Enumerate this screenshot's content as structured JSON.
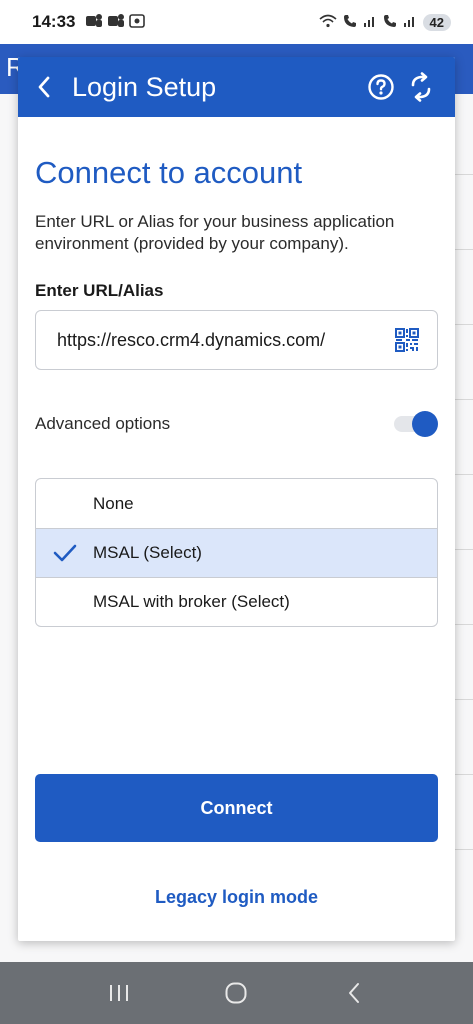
{
  "status_bar": {
    "time": "14:33",
    "battery": "42"
  },
  "background_app": {
    "title_letter": "R"
  },
  "dialog": {
    "title": "Login Setup",
    "heading": "Connect to account",
    "description": "Enter URL or Alias for your business application environment (provided by your company).",
    "url_label": "Enter URL/Alias",
    "url_value": "https://resco.crm4.dynamics.com/",
    "advanced_options_label": "Advanced options",
    "advanced_options_enabled": true,
    "auth_options": [
      {
        "label": "None",
        "selected": false
      },
      {
        "label": "MSAL (Select)",
        "selected": true
      },
      {
        "label": "MSAL with broker (Select)",
        "selected": false
      }
    ],
    "connect_label": "Connect",
    "legacy_label": "Legacy login mode"
  },
  "colors": {
    "primary": "#1f5bc2",
    "selected_row": "#dbe6fa",
    "nav_bar": "#6b6f74"
  }
}
